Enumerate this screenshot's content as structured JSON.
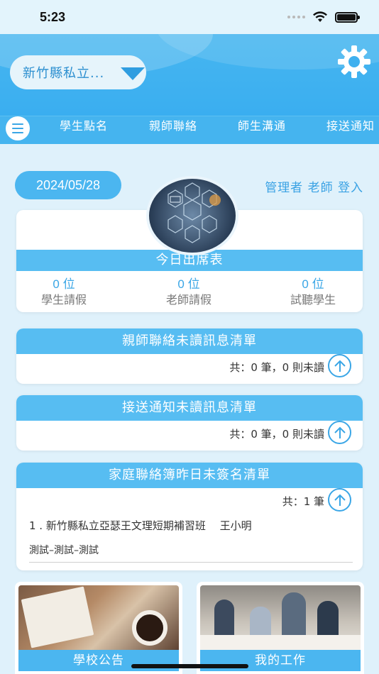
{
  "status_bar": {
    "time": "5:23"
  },
  "header": {
    "school_select": "新竹縣私立..."
  },
  "tabs": [
    "學生點名",
    "親師聯絡",
    "師生溝通",
    "接送通知"
  ],
  "date": "2024/05/28",
  "login_text": "管理者 老師 登入",
  "attendance": {
    "title": "今日出席表",
    "stats": [
      {
        "value": "0 位",
        "label": "學生請假"
      },
      {
        "value": "0 位",
        "label": "老師請假"
      },
      {
        "value": "0 位",
        "label": "試聽學生"
      }
    ]
  },
  "parent_teacher": {
    "title": "親師聯絡未讀訊息清單",
    "count": "共：0 筆，0 則未讀"
  },
  "pickup": {
    "title": "接送通知未讀訊息清單",
    "count": "共：0 筆，0 則未讀"
  },
  "family_book": {
    "title": "家庭聯絡簿昨日未簽名清單",
    "count": "共：1 筆",
    "item_line1": "1 . 新竹縣私立亞瑟王文理短期補習班　 王小明",
    "item_line2": "測試–測試–測試"
  },
  "tiles": {
    "announcements": "學校公告",
    "my_work": "我的工作"
  },
  "colors": {
    "accent": "#4bb6f0",
    "background": "#dff1fb"
  }
}
